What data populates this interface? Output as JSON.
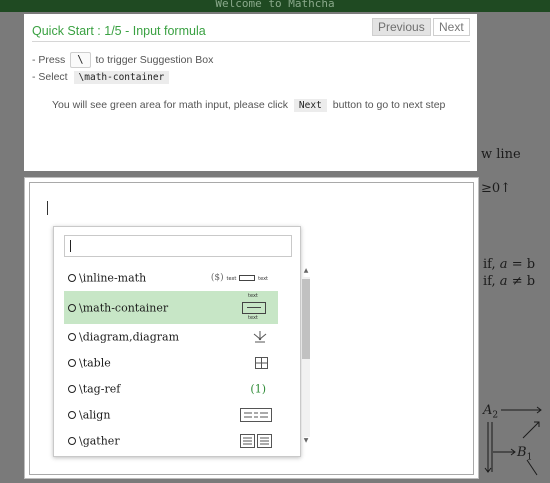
{
  "app": {
    "banner": "Welcome to Mathcha"
  },
  "background": {
    "line_text": "w line",
    "frag_right": "≥0↑",
    "case1_if": "if,",
    "case1_var": "a",
    "case1_rhs": "= b",
    "case2_if": "if,",
    "case2_var": "a",
    "case2_rhs": "≠ b",
    "a2_label": "A",
    "a2_sub": "2",
    "b1_label": "B",
    "b1_sub": "1"
  },
  "tutorial": {
    "title": "Quick Start : 1/5 - Input formula",
    "previous_label": "Previous",
    "next_label": "Next",
    "step1_prefix": "- Press",
    "step1_key": "\\",
    "step1_suffix": "to trigger Suggestion Box",
    "step2_prefix": "- Select",
    "step2_code": "\\math-container",
    "note_prefix": "You will see green area for math input, please click",
    "note_code": "Next",
    "note_suffix": "button to go to next step"
  },
  "suggestion": {
    "items": [
      {
        "label": "\\inline-math",
        "preview": "($) text ▭ text"
      },
      {
        "label": "\\math-container",
        "preview": "math container"
      },
      {
        "label": "\\diagram,diagram",
        "preview": "diagram"
      },
      {
        "label": "\\table",
        "preview": "table"
      },
      {
        "label": "\\tag-ref",
        "preview": "(1)"
      },
      {
        "label": "\\align",
        "preview": "align"
      },
      {
        "label": "\\gather",
        "preview": "gather"
      }
    ],
    "mc_text_top": "text",
    "mc_text_bottom": "text",
    "inline_text_a": "text",
    "inline_text_b": "text",
    "inline_dollar": "($)"
  },
  "colors": {
    "accent_green": "#3aa142",
    "selection": "#c7e6c6"
  }
}
